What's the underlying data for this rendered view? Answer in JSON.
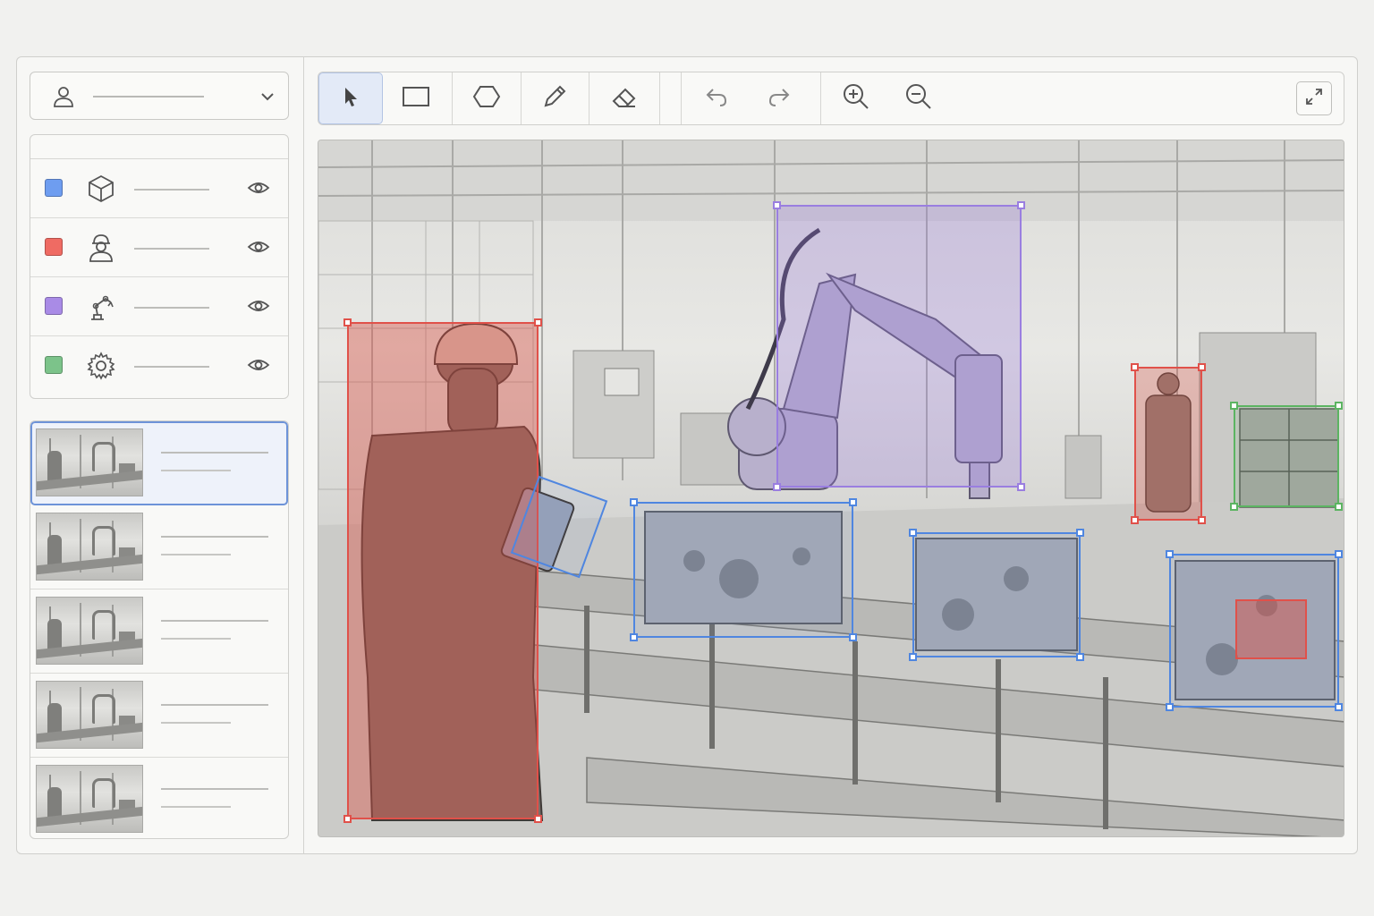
{
  "user_selector": {
    "name": "",
    "icon": "user-icon",
    "expand_icon": "chevron-down-icon"
  },
  "classes": [
    {
      "color": "#6e9df0",
      "icon": "cube-icon",
      "label": "",
      "visibility_icon": "eye-icon"
    },
    {
      "color": "#ef6b63",
      "icon": "worker-icon",
      "label": "",
      "visibility_icon": "eye-icon"
    },
    {
      "color": "#a98be6",
      "icon": "robot-arm-icon",
      "label": "",
      "visibility_icon": "eye-icon"
    },
    {
      "color": "#7cc38a",
      "icon": "gear-icon",
      "label": "",
      "visibility_icon": "eye-icon"
    }
  ],
  "thumbnails": [
    {
      "title": "",
      "selected": true
    },
    {
      "title": "",
      "selected": false
    },
    {
      "title": "",
      "selected": false
    },
    {
      "title": "",
      "selected": false
    },
    {
      "title": "",
      "selected": false
    }
  ],
  "toolbar": {
    "tools": [
      "pointer-icon",
      "rectangle-icon",
      "polygon-icon",
      "pencil-icon",
      "eraser-icon",
      "undo-icon",
      "redo-icon",
      "zoom-in-icon",
      "zoom-out-icon"
    ],
    "active_tool": "pointer-icon",
    "fullscreen_icon": "expand-icon"
  },
  "annotations": [
    {
      "class": "worker",
      "color": "#e0514a"
    },
    {
      "class": "worker",
      "color": "#e0514a"
    },
    {
      "class": "robot-arm",
      "color": "#9a7ee0"
    },
    {
      "class": "object",
      "color": "#4f86e0"
    },
    {
      "class": "object",
      "color": "#4f86e0"
    },
    {
      "class": "object",
      "color": "#4f86e0"
    },
    {
      "class": "object",
      "color": "#4f86e0"
    },
    {
      "class": "machinery",
      "color": "#5cb462"
    },
    {
      "class": "defect",
      "color": "#e0514a"
    }
  ]
}
